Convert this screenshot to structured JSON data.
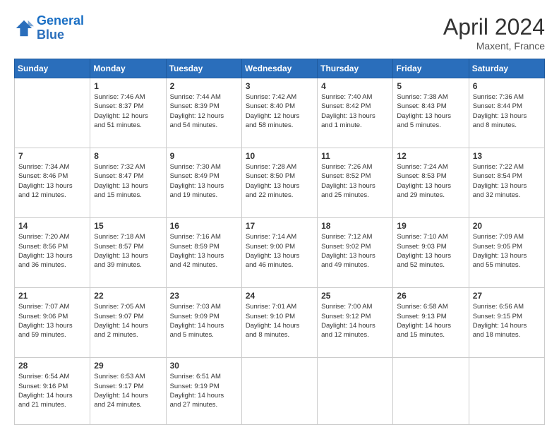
{
  "header": {
    "logo_line1": "General",
    "logo_line2": "Blue",
    "month_title": "April 2024",
    "location": "Maxent, France"
  },
  "weekdays": [
    "Sunday",
    "Monday",
    "Tuesday",
    "Wednesday",
    "Thursday",
    "Friday",
    "Saturday"
  ],
  "weeks": [
    [
      {
        "day": "",
        "info": ""
      },
      {
        "day": "1",
        "info": "Sunrise: 7:46 AM\nSunset: 8:37 PM\nDaylight: 12 hours\nand 51 minutes."
      },
      {
        "day": "2",
        "info": "Sunrise: 7:44 AM\nSunset: 8:39 PM\nDaylight: 12 hours\nand 54 minutes."
      },
      {
        "day": "3",
        "info": "Sunrise: 7:42 AM\nSunset: 8:40 PM\nDaylight: 12 hours\nand 58 minutes."
      },
      {
        "day": "4",
        "info": "Sunrise: 7:40 AM\nSunset: 8:42 PM\nDaylight: 13 hours\nand 1 minute."
      },
      {
        "day": "5",
        "info": "Sunrise: 7:38 AM\nSunset: 8:43 PM\nDaylight: 13 hours\nand 5 minutes."
      },
      {
        "day": "6",
        "info": "Sunrise: 7:36 AM\nSunset: 8:44 PM\nDaylight: 13 hours\nand 8 minutes."
      }
    ],
    [
      {
        "day": "7",
        "info": "Sunrise: 7:34 AM\nSunset: 8:46 PM\nDaylight: 13 hours\nand 12 minutes."
      },
      {
        "day": "8",
        "info": "Sunrise: 7:32 AM\nSunset: 8:47 PM\nDaylight: 13 hours\nand 15 minutes."
      },
      {
        "day": "9",
        "info": "Sunrise: 7:30 AM\nSunset: 8:49 PM\nDaylight: 13 hours\nand 19 minutes."
      },
      {
        "day": "10",
        "info": "Sunrise: 7:28 AM\nSunset: 8:50 PM\nDaylight: 13 hours\nand 22 minutes."
      },
      {
        "day": "11",
        "info": "Sunrise: 7:26 AM\nSunset: 8:52 PM\nDaylight: 13 hours\nand 25 minutes."
      },
      {
        "day": "12",
        "info": "Sunrise: 7:24 AM\nSunset: 8:53 PM\nDaylight: 13 hours\nand 29 minutes."
      },
      {
        "day": "13",
        "info": "Sunrise: 7:22 AM\nSunset: 8:54 PM\nDaylight: 13 hours\nand 32 minutes."
      }
    ],
    [
      {
        "day": "14",
        "info": "Sunrise: 7:20 AM\nSunset: 8:56 PM\nDaylight: 13 hours\nand 36 minutes."
      },
      {
        "day": "15",
        "info": "Sunrise: 7:18 AM\nSunset: 8:57 PM\nDaylight: 13 hours\nand 39 minutes."
      },
      {
        "day": "16",
        "info": "Sunrise: 7:16 AM\nSunset: 8:59 PM\nDaylight: 13 hours\nand 42 minutes."
      },
      {
        "day": "17",
        "info": "Sunrise: 7:14 AM\nSunset: 9:00 PM\nDaylight: 13 hours\nand 46 minutes."
      },
      {
        "day": "18",
        "info": "Sunrise: 7:12 AM\nSunset: 9:02 PM\nDaylight: 13 hours\nand 49 minutes."
      },
      {
        "day": "19",
        "info": "Sunrise: 7:10 AM\nSunset: 9:03 PM\nDaylight: 13 hours\nand 52 minutes."
      },
      {
        "day": "20",
        "info": "Sunrise: 7:09 AM\nSunset: 9:05 PM\nDaylight: 13 hours\nand 55 minutes."
      }
    ],
    [
      {
        "day": "21",
        "info": "Sunrise: 7:07 AM\nSunset: 9:06 PM\nDaylight: 13 hours\nand 59 minutes."
      },
      {
        "day": "22",
        "info": "Sunrise: 7:05 AM\nSunset: 9:07 PM\nDaylight: 14 hours\nand 2 minutes."
      },
      {
        "day": "23",
        "info": "Sunrise: 7:03 AM\nSunset: 9:09 PM\nDaylight: 14 hours\nand 5 minutes."
      },
      {
        "day": "24",
        "info": "Sunrise: 7:01 AM\nSunset: 9:10 PM\nDaylight: 14 hours\nand 8 minutes."
      },
      {
        "day": "25",
        "info": "Sunrise: 7:00 AM\nSunset: 9:12 PM\nDaylight: 14 hours\nand 12 minutes."
      },
      {
        "day": "26",
        "info": "Sunrise: 6:58 AM\nSunset: 9:13 PM\nDaylight: 14 hours\nand 15 minutes."
      },
      {
        "day": "27",
        "info": "Sunrise: 6:56 AM\nSunset: 9:15 PM\nDaylight: 14 hours\nand 18 minutes."
      }
    ],
    [
      {
        "day": "28",
        "info": "Sunrise: 6:54 AM\nSunset: 9:16 PM\nDaylight: 14 hours\nand 21 minutes."
      },
      {
        "day": "29",
        "info": "Sunrise: 6:53 AM\nSunset: 9:17 PM\nDaylight: 14 hours\nand 24 minutes."
      },
      {
        "day": "30",
        "info": "Sunrise: 6:51 AM\nSunset: 9:19 PM\nDaylight: 14 hours\nand 27 minutes."
      },
      {
        "day": "",
        "info": ""
      },
      {
        "day": "",
        "info": ""
      },
      {
        "day": "",
        "info": ""
      },
      {
        "day": "",
        "info": ""
      }
    ]
  ]
}
